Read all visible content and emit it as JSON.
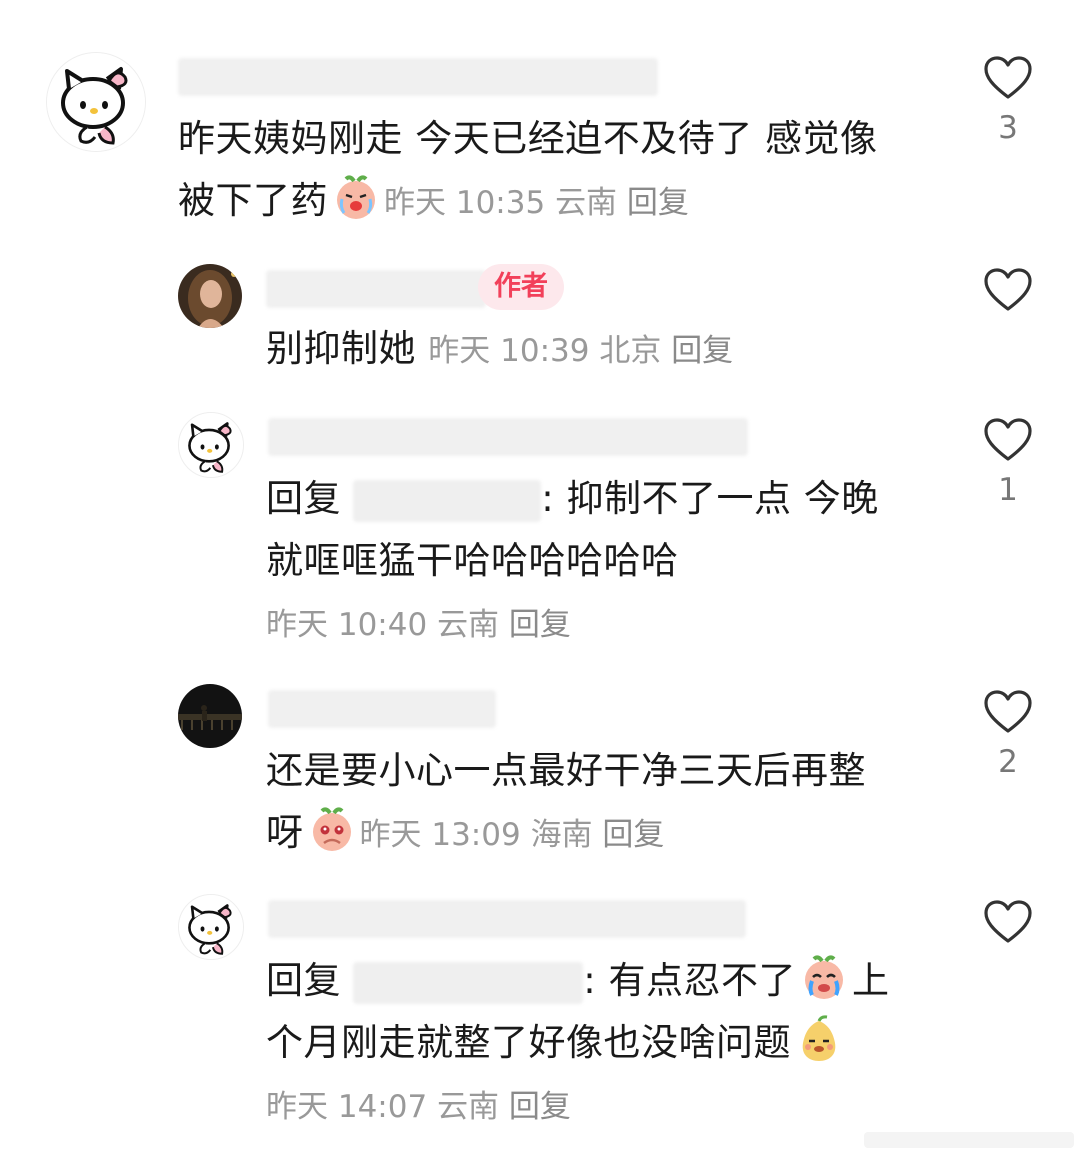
{
  "comments": [
    {
      "text_line1": "昨天姨妈刚走 今天已经迫不及待了 感觉像",
      "text_line2": "被下了药",
      "time": "昨天 10:35",
      "location": "云南",
      "reply": "回复",
      "likes": "3",
      "emoji": "crying-peach-emoji"
    },
    {
      "badge": "作者",
      "text": "别抑制她",
      "time": "昨天 10:39",
      "location": "北京",
      "reply": "回复",
      "likes": ""
    },
    {
      "reply_prefix": "回复",
      "text_line1": ": 抑制不了一点 今晚",
      "text_line2": "就哐哐猛干哈哈哈哈哈哈",
      "time": "昨天 10:40",
      "location": "云南",
      "reply": "回复",
      "likes": "1"
    },
    {
      "text_line1": "还是要小心一点最好干净三天后再整",
      "text_line2": "呀",
      "time": "昨天 13:09",
      "location": "海南",
      "reply": "回复",
      "likes": "2",
      "emoji": "shy-peach-emoji"
    },
    {
      "reply_prefix": "回复",
      "text_line1_a": ": 有点忍不了",
      "text_line1_b": "上",
      "text_line2": "个月刚走就整了好像也没啥问题",
      "time": "昨天 14:07",
      "location": "云南",
      "reply": "回复",
      "likes": "",
      "emoji1": "teary-peach-emoji",
      "emoji2": "smug-pear-emoji"
    }
  ],
  "colors": {
    "badge_text": "#f2405a",
    "badge_bg": "#fde8ec",
    "meta": "#999999"
  }
}
